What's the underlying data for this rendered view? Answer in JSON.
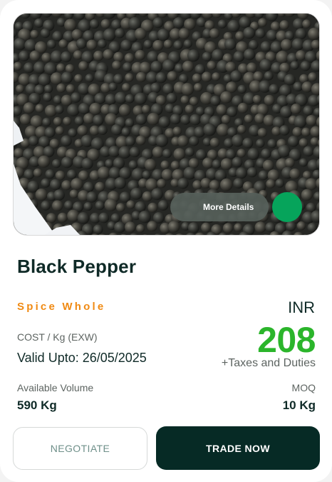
{
  "product": {
    "image_icon": "black-pepper-photo",
    "more_details_label": "More Details",
    "name": "Black Pepper",
    "category": "Spice Whole",
    "currency": "INR",
    "cost_label": "COST / Kg (EXW)",
    "price": "208",
    "taxes_note": "+Taxes and Duties",
    "valid_upto": "Valid Upto: 26/05/2025",
    "available_volume_label": "Available Volume",
    "available_volume_value": "590 Kg",
    "moq_label": "MOQ",
    "moq_value": "10 Kg"
  },
  "actions": {
    "negotiate_label": "NEGOTIATE",
    "trade_label": "TRADE NOW"
  },
  "colors": {
    "accent_green": "#2bb52b",
    "category_orange": "#f08a13",
    "primary_dark": "#062a25",
    "status_dot": "#06a45b"
  }
}
